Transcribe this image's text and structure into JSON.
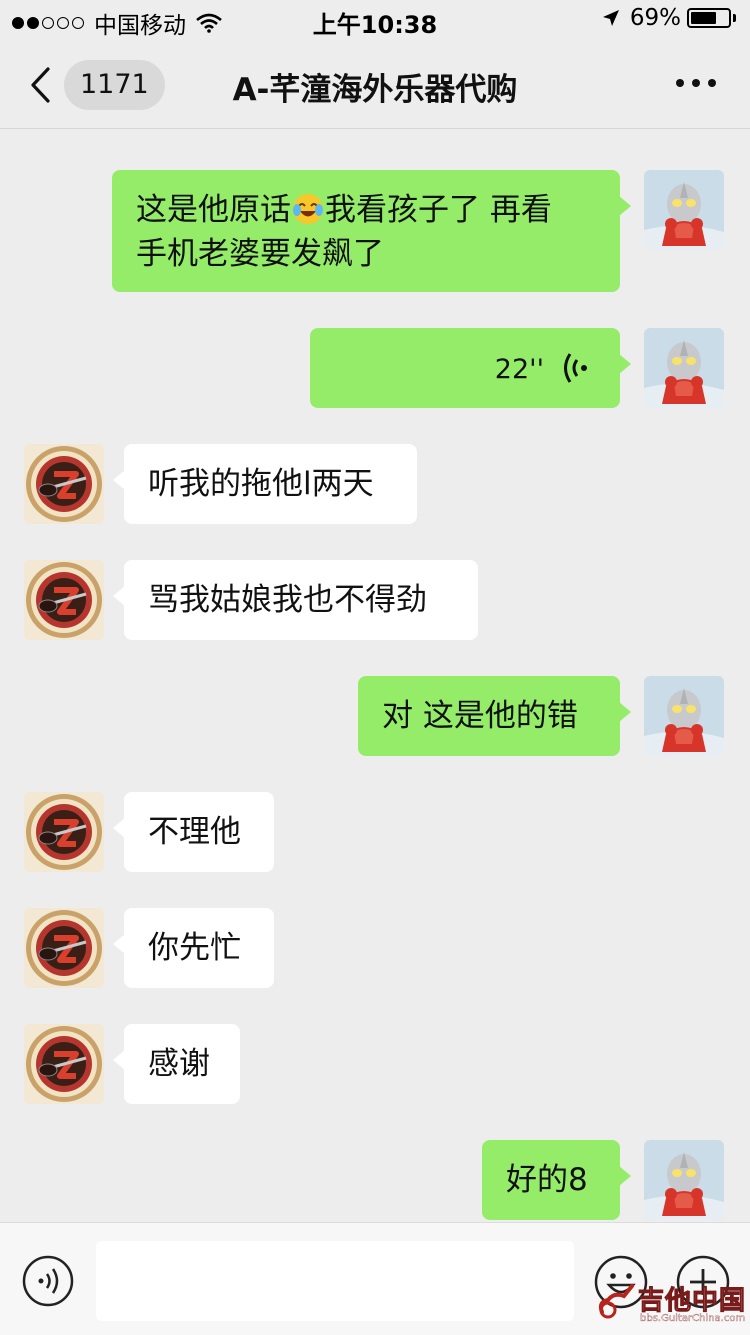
{
  "status_bar": {
    "carrier": "中国移动",
    "time": "上午10:38",
    "battery_percent": "69%",
    "battery_level": 0.69
  },
  "nav": {
    "unread_count": "1171",
    "title": "A-芊潼海外乐器代购"
  },
  "messages": [
    {
      "side": "out",
      "type": "text",
      "text_before_emoji": "这是他原话",
      "emoji": "face-with-tears-of-joy",
      "text_after_emoji": "我看孩子了 再看",
      "text_line2": "手机老婆要发飙了"
    },
    {
      "side": "out",
      "type": "voice",
      "duration": "22''"
    },
    {
      "side": "in",
      "type": "text",
      "text": "听我的拖他l两天"
    },
    {
      "side": "in",
      "type": "text",
      "text": "骂我姑娘我也不得劲"
    },
    {
      "side": "out",
      "type": "text",
      "text": "对 这是他的错"
    },
    {
      "side": "in",
      "type": "text",
      "text": "不理他"
    },
    {
      "side": "in",
      "type": "text",
      "text": "你先忙"
    },
    {
      "side": "in",
      "type": "text",
      "text": "感谢"
    },
    {
      "side": "out",
      "type": "text",
      "text": "好的8"
    }
  ],
  "watermark": {
    "title": "吉他中国",
    "subtitle": "bbs.GuitarChina.com"
  },
  "colors": {
    "outgoing_bubble": "#95ec69",
    "incoming_bubble": "#ffffff",
    "background": "#ededed"
  }
}
